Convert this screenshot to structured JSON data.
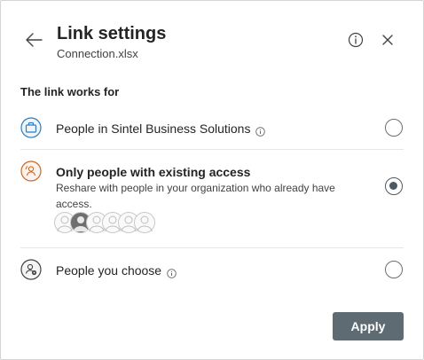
{
  "header": {
    "title": "Link settings",
    "filename": "Connection.xlsx"
  },
  "section": {
    "heading": "The link works for"
  },
  "options": [
    {
      "label": "People in Sintel Business Solutions",
      "icon": "briefcase-icon",
      "selected": false
    },
    {
      "label": "Only people with existing access",
      "description": "Reshare with people in your organization who already have access.",
      "icon": "refresh-person-icon",
      "selected": true,
      "avatar_count": 6
    },
    {
      "label": "People you choose",
      "icon": "person-settings-icon",
      "selected": false
    }
  ],
  "footer": {
    "apply_label": "Apply"
  },
  "colors": {
    "primary_button": "#5f6b73",
    "radio_selected": "#4d5a63",
    "org_icon": "#2f7bbf",
    "existing_access_icon": "#c46a2a"
  }
}
